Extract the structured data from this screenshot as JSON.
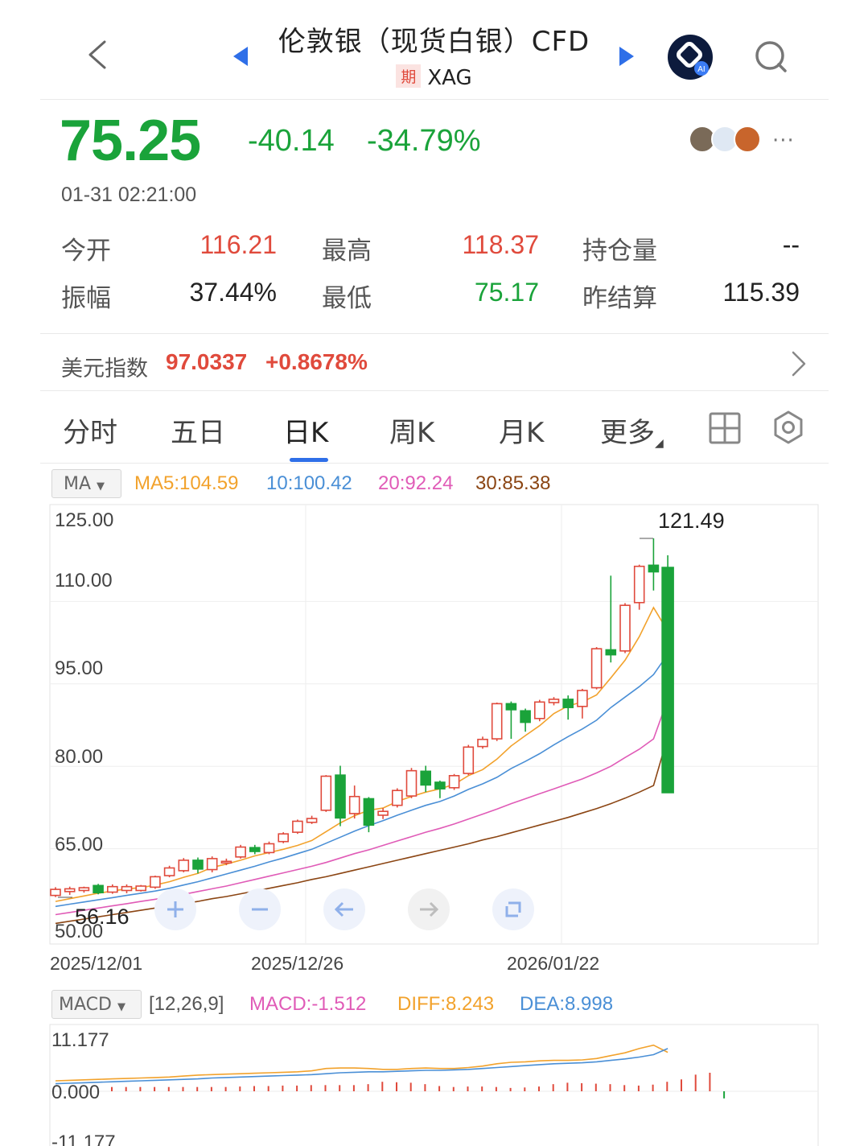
{
  "header": {
    "title": "伦敦银（现货白银）CFD",
    "badge": "期",
    "symbol": "XAG"
  },
  "quote": {
    "price": "75.25",
    "change": "-40.14",
    "change_pct": "-34.79%",
    "time": "01-31 02:21:00"
  },
  "more_label": "···",
  "stats": [
    {
      "label": "今开",
      "value": "116.21",
      "color": "#e04a3c"
    },
    {
      "label": "最高",
      "value": "118.37",
      "color": "#e04a3c"
    },
    {
      "label": "持仓量",
      "value": "--",
      "color": "#222222"
    },
    {
      "label": "振幅",
      "value": "37.44%",
      "color": "#222222"
    },
    {
      "label": "最低",
      "value": "75.17",
      "color": "#1aa33a"
    },
    {
      "label": "昨结算",
      "value": "115.39",
      "color": "#222222"
    }
  ],
  "usd_index": {
    "label": "美元指数",
    "value": "97.0337",
    "change": "+0.8678%"
  },
  "tabs": [
    {
      "label": "分时"
    },
    {
      "label": "五日"
    },
    {
      "label": "日K"
    },
    {
      "label": "周K"
    },
    {
      "label": "月K"
    },
    {
      "label": "更多"
    }
  ],
  "active_tab": "日K",
  "ma": {
    "selector": "MA",
    "ma5": "MA5:104.59",
    "ma10": "10:100.42",
    "ma20": "20:92.24",
    "ma30": "30:85.38",
    "colors": {
      "ma5": "#f2a22c",
      "ma10": "#4a8fd6",
      "ma20": "#e05bb7",
      "ma30": "#8b4513"
    }
  },
  "chart_data": {
    "type": "candlestick",
    "y_ticks": [
      "125.00",
      "110.00",
      "95.00",
      "80.00",
      "65.00",
      "50.00"
    ],
    "ylim": [
      50,
      125
    ],
    "x_ticks": [
      "2025/12/01",
      "2025/12/26",
      "2026/01/22"
    ],
    "max_label": "121.49",
    "min_label": "56.16",
    "up_color": "#e04a3c",
    "down_color": "#1aa33a",
    "candles": [
      {
        "o": 56.5,
        "c": 57.6,
        "h": 58.0,
        "l": 56.2
      },
      {
        "o": 57.2,
        "c": 57.7,
        "h": 58.1,
        "l": 56.6
      },
      {
        "o": 57.4,
        "c": 57.9,
        "h": 58.1,
        "l": 57.0
      },
      {
        "o": 58.3,
        "c": 57.0,
        "h": 58.6,
        "l": 56.7
      },
      {
        "o": 57.1,
        "c": 58.1,
        "h": 58.5,
        "l": 56.8
      },
      {
        "o": 57.4,
        "c": 58.1,
        "h": 58.5,
        "l": 56.9
      },
      {
        "o": 57.4,
        "c": 58.2,
        "h": 58.4,
        "l": 57.2
      },
      {
        "o": 58.0,
        "c": 59.9,
        "h": 60.1,
        "l": 57.7
      },
      {
        "o": 60.1,
        "c": 61.5,
        "h": 61.9,
        "l": 59.8
      },
      {
        "o": 61.0,
        "c": 62.9,
        "h": 63.3,
        "l": 60.7
      },
      {
        "o": 62.9,
        "c": 61.3,
        "h": 63.4,
        "l": 60.5
      },
      {
        "o": 61.2,
        "c": 63.2,
        "h": 63.6,
        "l": 60.7
      },
      {
        "o": 62.6,
        "c": 62.7,
        "h": 63.2,
        "l": 62.0
      },
      {
        "o": 63.5,
        "c": 65.3,
        "h": 65.7,
        "l": 63.2
      },
      {
        "o": 65.2,
        "c": 64.5,
        "h": 65.7,
        "l": 64.0
      },
      {
        "o": 64.3,
        "c": 65.9,
        "h": 66.3,
        "l": 64.0
      },
      {
        "o": 66.3,
        "c": 67.7,
        "h": 68.0,
        "l": 66.0
      },
      {
        "o": 68.0,
        "c": 70.0,
        "h": 70.3,
        "l": 67.7
      },
      {
        "o": 69.8,
        "c": 70.5,
        "h": 71.0,
        "l": 69.5
      },
      {
        "o": 72.0,
        "c": 78.2,
        "h": 78.4,
        "l": 71.7
      },
      {
        "o": 78.4,
        "c": 70.6,
        "h": 80.1,
        "l": 69.1
      },
      {
        "o": 71.4,
        "c": 74.5,
        "h": 76.5,
        "l": 70.5
      },
      {
        "o": 74.1,
        "c": 69.3,
        "h": 74.4,
        "l": 68.0
      },
      {
        "o": 71.1,
        "c": 71.8,
        "h": 72.4,
        "l": 70.4
      },
      {
        "o": 72.9,
        "c": 75.6,
        "h": 76.0,
        "l": 72.5
      },
      {
        "o": 74.6,
        "c": 79.2,
        "h": 79.7,
        "l": 74.2
      },
      {
        "o": 79.1,
        "c": 76.6,
        "h": 80.1,
        "l": 75.3
      },
      {
        "o": 77.1,
        "c": 75.9,
        "h": 77.4,
        "l": 74.2
      },
      {
        "o": 76.1,
        "c": 78.3,
        "h": 78.6,
        "l": 75.7
      },
      {
        "o": 78.7,
        "c": 83.5,
        "h": 83.9,
        "l": 78.4
      },
      {
        "o": 83.6,
        "c": 84.9,
        "h": 85.4,
        "l": 83.2
      },
      {
        "o": 85.0,
        "c": 91.4,
        "h": 91.6,
        "l": 84.6
      },
      {
        "o": 91.4,
        "c": 90.3,
        "h": 91.8,
        "l": 85.0
      },
      {
        "o": 90.1,
        "c": 88.0,
        "h": 90.5,
        "l": 86.3
      },
      {
        "o": 88.7,
        "c": 91.7,
        "h": 92.1,
        "l": 88.2
      },
      {
        "o": 91.6,
        "c": 92.2,
        "h": 92.6,
        "l": 91.1
      },
      {
        "o": 92.2,
        "c": 90.7,
        "h": 92.9,
        "l": 88.5
      },
      {
        "o": 90.9,
        "c": 93.8,
        "h": 94.1,
        "l": 88.7
      },
      {
        "o": 94.3,
        "c": 101.4,
        "h": 101.7,
        "l": 94.0
      },
      {
        "o": 101.2,
        "c": 100.3,
        "h": 114.7,
        "l": 98.9
      },
      {
        "o": 101.0,
        "c": 109.3,
        "h": 109.7,
        "l": 100.6
      },
      {
        "o": 109.8,
        "c": 116.4,
        "h": 116.7,
        "l": 108.5
      },
      {
        "o": 116.6,
        "c": 115.4,
        "h": 121.5,
        "l": 112.0
      },
      {
        "o": 116.2,
        "c": 75.2,
        "h": 118.4,
        "l": 75.2
      }
    ],
    "series": [
      {
        "name": "MA5",
        "values": [
          55.4,
          55.9,
          56.4,
          56.9,
          57.3,
          57.7,
          57.9,
          58.4,
          59.0,
          59.8,
          60.5,
          61.6,
          62.2,
          62.9,
          63.7,
          64.3,
          64.9,
          65.6,
          66.5,
          68.1,
          69.7,
          71.0,
          72.0,
          72.4,
          73.6,
          74.5,
          75.3,
          75.9,
          76.7,
          78.3,
          79.4,
          81.3,
          83.7,
          85.6,
          87.4,
          89.6,
          91.0,
          91.7,
          93.0,
          96.1,
          99.3,
          103.6,
          108.9,
          104.6
        ]
      },
      {
        "name": "MA10",
        "values": [
          54.5,
          54.9,
          55.3,
          55.7,
          56.1,
          56.5,
          56.9,
          57.3,
          57.8,
          58.4,
          59.0,
          59.7,
          60.4,
          61.1,
          61.8,
          62.6,
          63.3,
          64.1,
          64.9,
          66.0,
          67.1,
          68.2,
          69.2,
          70.1,
          71.1,
          72.0,
          72.9,
          73.6,
          74.6,
          75.8,
          76.8,
          78.0,
          79.6,
          80.9,
          82.3,
          83.9,
          85.4,
          86.8,
          88.4,
          90.7,
          92.6,
          94.5,
          96.7,
          100.4
        ]
      },
      {
        "name": "MA20",
        "values": [
          53.0,
          53.4,
          53.8,
          54.2,
          54.6,
          55.0,
          55.4,
          55.8,
          56.2,
          56.7,
          57.2,
          57.7,
          58.2,
          58.8,
          59.4,
          60.0,
          60.6,
          61.2,
          61.8,
          62.5,
          63.3,
          64.1,
          64.8,
          65.6,
          66.4,
          67.2,
          68.0,
          68.7,
          69.5,
          70.4,
          71.3,
          72.2,
          73.2,
          74.1,
          75.0,
          75.9,
          76.8,
          77.7,
          78.8,
          80.0,
          81.6,
          83.1,
          85.0,
          92.2
        ]
      },
      {
        "name": "MA30",
        "values": [
          51.4,
          51.8,
          52.2,
          52.6,
          53.0,
          53.4,
          53.8,
          54.2,
          54.6,
          55.0,
          55.4,
          55.9,
          56.3,
          56.8,
          57.3,
          57.8,
          58.3,
          58.8,
          59.4,
          59.9,
          60.5,
          61.1,
          61.7,
          62.3,
          62.9,
          63.5,
          64.1,
          64.7,
          65.3,
          65.9,
          66.6,
          67.2,
          67.9,
          68.6,
          69.3,
          70.0,
          70.7,
          71.5,
          72.3,
          73.2,
          74.2,
          75.3,
          76.5,
          85.4
        ]
      }
    ]
  },
  "macd": {
    "selector": "MACD",
    "params": "[12,26,9]",
    "macd": "MACD:-1.512",
    "diff": "DIFF:8.243",
    "dea": "DEA:8.998",
    "colors": {
      "macd": "#e05bb7",
      "diff": "#f2a22c",
      "dea": "#4a8fd6"
    },
    "y_ticks": [
      "11.177",
      "0.000",
      "-11.177"
    ],
    "ylim": [
      -11.177,
      11.177
    ],
    "diff_values": [
      2.2,
      2.3,
      2.4,
      2.5,
      2.6,
      2.7,
      2.8,
      2.9,
      3.0,
      3.2,
      3.4,
      3.5,
      3.6,
      3.7,
      3.8,
      3.9,
      4.0,
      4.1,
      4.3,
      4.8,
      4.9,
      4.9,
      4.8,
      4.6,
      4.6,
      4.8,
      4.9,
      4.8,
      4.8,
      5.0,
      5.3,
      5.8,
      6.1,
      6.2,
      6.4,
      6.5,
      6.5,
      6.6,
      6.9,
      7.5,
      8.1,
      9.0,
      9.7,
      8.2
    ],
    "dea_values": [
      1.6,
      1.7,
      1.8,
      1.9,
      2.0,
      2.1,
      2.2,
      2.3,
      2.4,
      2.5,
      2.6,
      2.8,
      2.9,
      3.0,
      3.1,
      3.2,
      3.3,
      3.4,
      3.5,
      3.7,
      3.9,
      4.0,
      4.1,
      4.1,
      4.2,
      4.3,
      4.4,
      4.4,
      4.5,
      4.6,
      4.8,
      5.0,
      5.2,
      5.4,
      5.6,
      5.8,
      5.9,
      6.0,
      6.2,
      6.5,
      6.8,
      7.2,
      7.7,
      9.0
    ],
    "hist_values": [
      0.9,
      0.9,
      0.9,
      0.9,
      0.9,
      0.9,
      0.9,
      0.9,
      0.9,
      1.0,
      1.1,
      1.1,
      1.2,
      1.2,
      1.3,
      1.3,
      1.3,
      1.3,
      1.5,
      2.0,
      1.9,
      1.8,
      1.5,
      1.1,
      0.9,
      1.0,
      1.0,
      0.9,
      0.7,
      0.8,
      1.0,
      1.5,
      1.8,
      1.7,
      1.6,
      1.5,
      1.3,
      1.2,
      1.4,
      2.0,
      2.5,
      3.5,
      3.9,
      -1.5
    ]
  }
}
